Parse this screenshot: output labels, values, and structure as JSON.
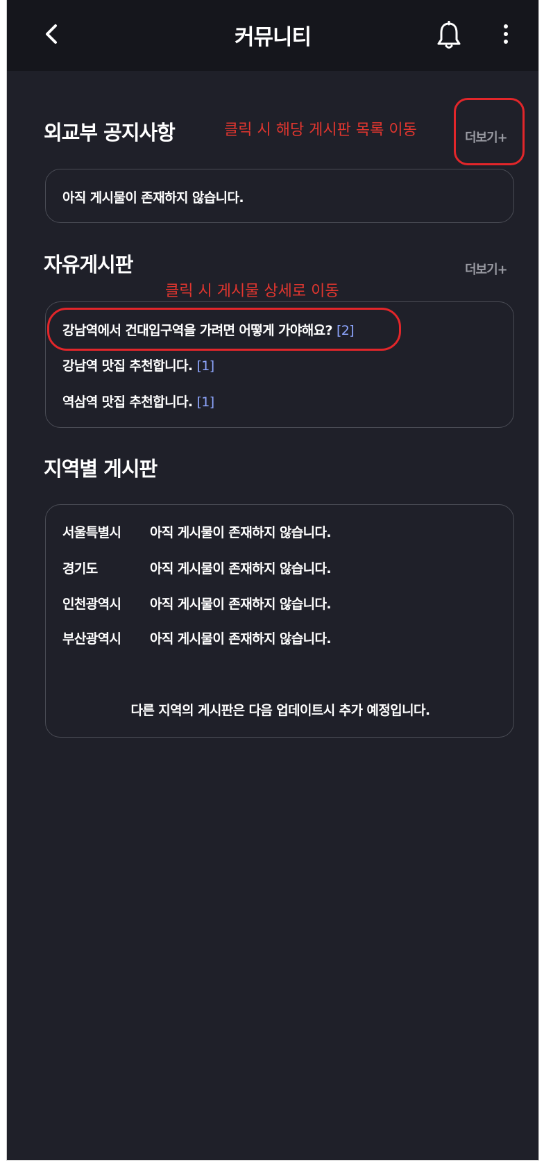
{
  "header": {
    "title": "커뮤니티",
    "icons": [
      "back-icon",
      "bell-icon",
      "more-vertical-icon"
    ]
  },
  "notice": {
    "title": "외교부 공지사항",
    "more_label": "더보기+",
    "empty_text": "아직 게시물이 존재하지 않습니다.",
    "annotation": "클릭 시 해당 게시판 목록 이동"
  },
  "free_board": {
    "title": "자유게시판",
    "more_label": "더보기+",
    "annotation": "클릭 시 게시물 상세로 이동",
    "posts": [
      {
        "title": "강남역에서 건대입구역을 가려면 어떻게 가야해요?",
        "count": "[2]"
      },
      {
        "title": "강남역 맛집 추천합니다.",
        "count": "[1]"
      },
      {
        "title": "역삼역 맛집 추천합니다.",
        "count": "[1]"
      }
    ]
  },
  "regional": {
    "title": "지역별 게시판",
    "regions": [
      {
        "name": "서울특별시",
        "message": "아직 게시물이 존재하지 않습니다."
      },
      {
        "name": "경기도",
        "message": "아직 게시물이 존재하지 않습니다."
      },
      {
        "name": "인천광역시",
        "message": "아직 게시물이 존재하지 않습니다."
      },
      {
        "name": "부산광역시",
        "message": "아직 게시물이 존재하지 않습니다."
      }
    ],
    "footer": "다른 지역의 게시판은 다음 업데이트시 추가 예정입니다."
  },
  "colors": {
    "background": "#1f2029",
    "topbar": "#15161c",
    "annotation": "#e2362f",
    "comment_count": "#8ea6ff"
  }
}
